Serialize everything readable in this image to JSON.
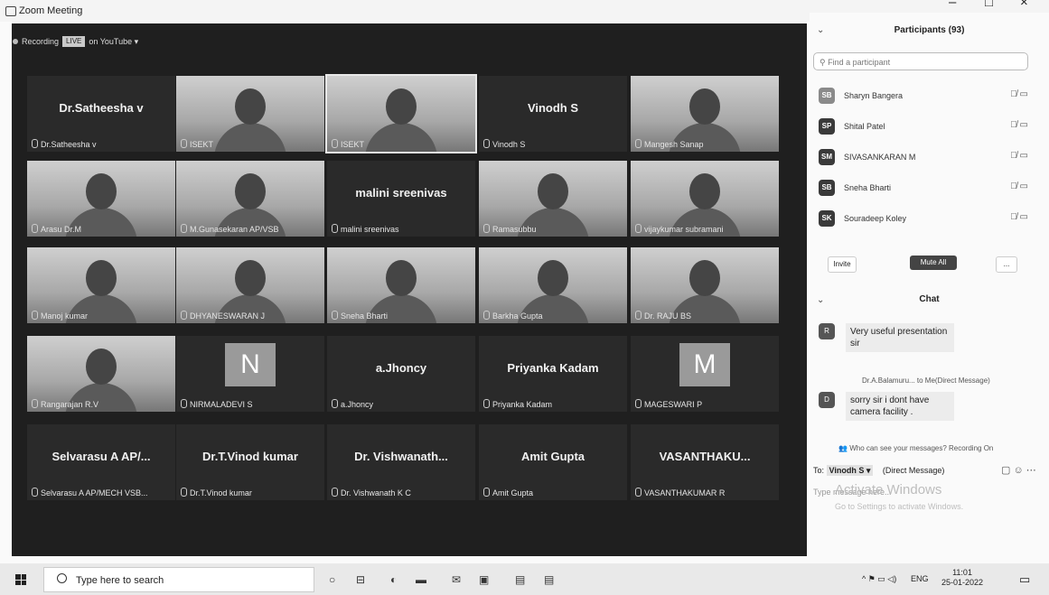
{
  "window": {
    "title": "Zoom Meeting",
    "min": "–",
    "max": "□",
    "close": "×"
  },
  "recording": {
    "label": "Recording",
    "live": "LIVE",
    "platform": "on YouTube ▾"
  },
  "tiles": [
    {
      "big": "Dr.Satheesha v",
      "name": "Dr.Satheesha v"
    },
    {
      "name": "ISEKT"
    },
    {
      "name": "ISEKT"
    },
    {
      "big": "Vinodh S",
      "name": "Vinodh S"
    },
    {
      "name": "Mangesh Sanap"
    },
    {
      "name": "Arasu Dr.M"
    },
    {
      "name": "M.Gunasekaran AP/VSB"
    },
    {
      "big": "malini sreenivas",
      "name": "malini sreenivas"
    },
    {
      "name": "Ramasubbu"
    },
    {
      "name": "vijaykumar subramani"
    },
    {
      "name": "Manoj kumar"
    },
    {
      "name": "DHYANESWARAN J"
    },
    {
      "name": "Sneha Bharti"
    },
    {
      "name": "Barkha Gupta"
    },
    {
      "name": "Dr. RAJU BS"
    },
    {
      "name": "Rangarajan R.V"
    },
    {
      "avatar": "N",
      "name": "NIRMALADEVI S"
    },
    {
      "big": "a.Jhoncy",
      "name": "a.Jhoncy"
    },
    {
      "big": "Priyanka Kadam",
      "name": "Priyanka Kadam"
    },
    {
      "avatar": "M",
      "name": "MAGESWARI P"
    },
    {
      "big": "Selvarasu A AP/...",
      "name": "Selvarasu A AP/MECH VSB..."
    },
    {
      "big": "Dr.T.Vinod kumar",
      "name": "Dr.T.Vinod kumar"
    },
    {
      "big": "Dr. Vishwanath...",
      "name": "Dr. Vishwanath K C"
    },
    {
      "big": "Amit Gupta",
      "name": "Amit Gupta"
    },
    {
      "big": "VASANTHAKU...",
      "name": "VASANTHAKUMAR R"
    }
  ],
  "participants": {
    "title": "Participants (93)",
    "search_placeholder": "Find a participant",
    "list": [
      {
        "initials": "SB",
        "name": "Sharyn Bangera"
      },
      {
        "initials": "SP",
        "name": "Shital Patel"
      },
      {
        "initials": "SM",
        "name": "SIVASANKARAN M"
      },
      {
        "initials": "SB",
        "name": "Sneha Bharti"
      },
      {
        "initials": "SK",
        "name": "Souradeep Koley"
      }
    ],
    "invite": "Invite",
    "mute_all": "Mute All",
    "more": "..."
  },
  "chat": {
    "title": "Chat",
    "messages": [
      {
        "avatar": "R",
        "text": "Very useful presentation sir"
      },
      {
        "avatar": "D",
        "meta": "Dr.A.Balamuru... to Me(Direct Message)",
        "text": "sorry sir i dont have camera facility ."
      }
    ],
    "visibility_note": "Who can see your messages? Recording On",
    "to_label": "To:",
    "to_value": "Vinodh S ▾",
    "dm_label": "(Direct Message)",
    "input_placeholder": "Type message here...",
    "watermark_1": "Activate Windows",
    "watermark_2": "Go to Settings to activate Windows."
  },
  "taskbar": {
    "search_placeholder": "Type here to search",
    "lang": "ENG",
    "time": "11:01",
    "date": "25-01-2022"
  }
}
